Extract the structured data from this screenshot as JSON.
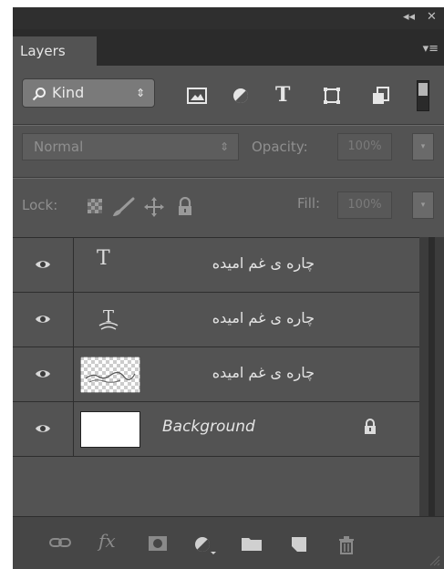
{
  "window": {
    "collapse_icon": "double-chevron-icon",
    "collapse_label": "◂◂",
    "close_label": "✕"
  },
  "tabs": [
    {
      "label": "Layers"
    }
  ],
  "panel_menu_label": "▾≡",
  "filter": {
    "kind_label": "Kind",
    "kind_arrows": "⇕",
    "icons": [
      "pixel-filter-icon",
      "adjustment-filter-icon",
      "type-filter-icon",
      "shape-filter-icon",
      "smart-object-filter-icon"
    ],
    "type_glyph": "T"
  },
  "blend": {
    "mode": "Normal",
    "arrows": "⇕",
    "opacity_label": "Opacity:",
    "opacity_value": "100%"
  },
  "lock": {
    "label": "Lock:",
    "fill_label": "Fill:",
    "fill_value": "100%",
    "icons": [
      "lock-transparent-icon",
      "lock-image-brush-icon",
      "lock-position-icon",
      "lock-all-icon"
    ]
  },
  "dropdown_arrow": "▾",
  "layers": [
    {
      "name": "چاره ی غم امیده",
      "thumb": "type",
      "thumb_glyph": "T",
      "visible": true
    },
    {
      "name": "چاره ی غم امیده",
      "thumb": "warped-type",
      "thumb_glyph": "T",
      "visible": true
    },
    {
      "name": "چاره ی غم امیده",
      "thumb": "transparent",
      "visible": true
    },
    {
      "name": "Background",
      "thumb": "white",
      "visible": true,
      "locked": true
    }
  ],
  "bottom_icons": [
    "link-layers-icon",
    "fx-icon",
    "add-mask-icon",
    "adjustment-layer-icon",
    "new-group-icon",
    "new-layer-icon",
    "delete-icon"
  ],
  "fx_label": "fx",
  "colors": {
    "panel_bg": "#535353",
    "titlebar": "#2f2f2f",
    "text": "#e4e4e4"
  }
}
